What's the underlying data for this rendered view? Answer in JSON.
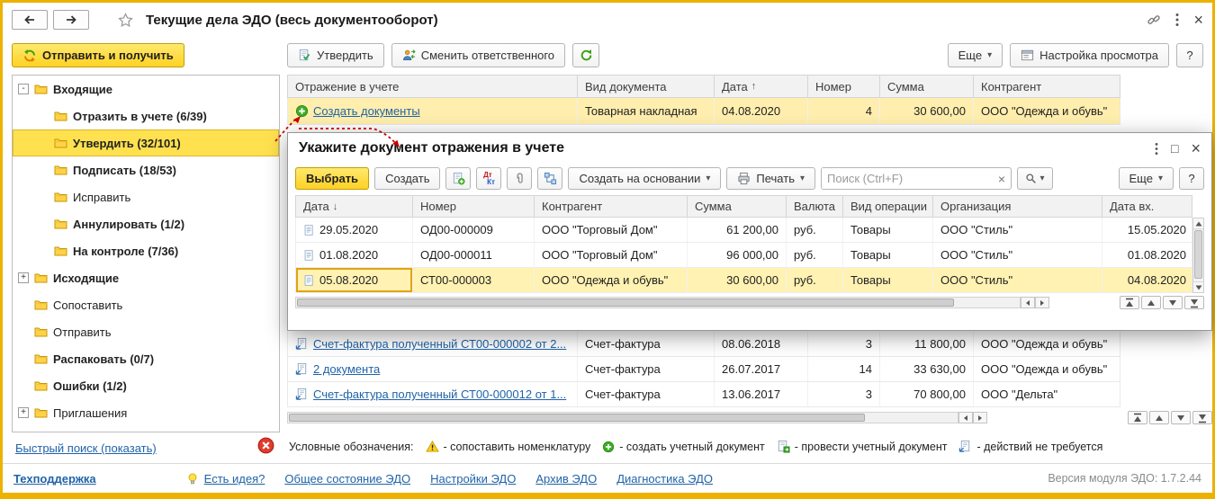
{
  "window": {
    "title": "Текущие дела ЭДО (весь документооборот)",
    "close": "×"
  },
  "toolbar": {
    "send_receive": "Отправить и получить",
    "approve": "Утвердить",
    "change_responsible": "Сменить ответственного",
    "more": "Еще",
    "caret": "▾",
    "view_settings": "Настройка просмотра",
    "help": "?"
  },
  "tree": {
    "items": [
      {
        "label": "Входящие",
        "level": 0,
        "bold": true,
        "expander": "-"
      },
      {
        "label": "Отразить в учете (6/39)",
        "level": 1,
        "bold": true
      },
      {
        "label": "Утвердить (32/101)",
        "level": 1,
        "bold": true,
        "selected": true
      },
      {
        "label": "Подписать (18/53)",
        "level": 1,
        "bold": true
      },
      {
        "label": "Исправить",
        "level": 1,
        "bold": false
      },
      {
        "label": "Аннулировать (1/2)",
        "level": 1,
        "bold": true
      },
      {
        "label": "На контроле (7/36)",
        "level": 1,
        "bold": true
      },
      {
        "label": "Исходящие",
        "level": 0,
        "bold": true,
        "expander": "+"
      },
      {
        "label": "Сопоставить",
        "level": 0,
        "bold": false
      },
      {
        "label": "Отправить",
        "level": 0,
        "bold": false
      },
      {
        "label": "Распаковать (0/7)",
        "level": 0,
        "bold": true
      },
      {
        "label": "Ошибки (1/2)",
        "level": 0,
        "bold": true
      },
      {
        "label": "Приглашения",
        "level": 0,
        "bold": false,
        "expander": "+"
      }
    ],
    "quick_search": "Быстрый поиск (показать)"
  },
  "main_table": {
    "columns": [
      {
        "label": "Отражение в учете"
      },
      {
        "label": "Вид документа"
      },
      {
        "label": "Дата",
        "sort": "↑"
      },
      {
        "label": "Номер"
      },
      {
        "label": "Сумма"
      },
      {
        "label": "Контрагент"
      }
    ],
    "rows": [
      {
        "doc": "Создать документы",
        "type": "Товарная накладная",
        "date": "04.08.2020",
        "number": "4",
        "sum": "30 600,00",
        "contragent": "ООО \"Одежда и обувь\""
      },
      {
        "doc": "Счет-фактура полученный СТ00-000002 от 2...",
        "type": "Счет-фактура",
        "date": "08.06.2018",
        "number": "3",
        "sum": "11 800,00",
        "contragent": "ООО \"Одежда и обувь\""
      },
      {
        "doc": "2 документа",
        "type": "Счет-фактура",
        "date": "26.07.2017",
        "number": "14",
        "sum": "33 630,00",
        "contragent": "ООО \"Одежда и обувь\""
      },
      {
        "doc": "Счет-фактура полученный СТ00-000012 от 1...",
        "type": "Счет-фактура",
        "date": "13.06.2017",
        "number": "3",
        "sum": "70 800,00",
        "contragent": "ООО \"Дельта\""
      }
    ]
  },
  "dialog": {
    "title": "Укажите документ отражения в учете",
    "maximize": "□",
    "close": "×",
    "toolbar": {
      "select": "Выбрать",
      "create": "Создать",
      "create_based": "Создать на основании",
      "print": "Печать",
      "search_placeholder": "Поиск (Ctrl+F)",
      "clear": "×",
      "more": "Еще",
      "help": "?",
      "dt": "Дт",
      "kt": "Кт"
    },
    "table": {
      "columns": [
        {
          "label": "Дата",
          "sort": "↓"
        },
        {
          "label": "Номер"
        },
        {
          "label": "Контрагент"
        },
        {
          "label": "Сумма"
        },
        {
          "label": "Валюта"
        },
        {
          "label": "Вид операции"
        },
        {
          "label": "Организация"
        },
        {
          "label": "Дата вх."
        }
      ],
      "rows": [
        {
          "date": "29.05.2020",
          "number": "ОД00-000009",
          "contragent": "ООО \"Торговый Дом\"",
          "sum": "61 200,00",
          "currency": "руб.",
          "operation": "Товары",
          "org": "ООО \"Стиль\"",
          "date_in": "15.05.2020"
        },
        {
          "date": "01.08.2020",
          "number": "ОД00-000011",
          "contragent": "ООО \"Торговый Дом\"",
          "sum": "96 000,00",
          "currency": "руб.",
          "operation": "Товары",
          "org": "ООО \"Стиль\"",
          "date_in": "01.08.2020"
        },
        {
          "date": "05.08.2020",
          "number": "СТ00-000003",
          "contragent": "ООО \"Одежда и обувь\"",
          "sum": "30 600,00",
          "currency": "руб.",
          "operation": "Товары",
          "org": "ООО \"Стиль\"",
          "date_in": "04.08.2020"
        }
      ]
    }
  },
  "legend": {
    "label": "Условные обозначения:",
    "items": [
      {
        "icon": "warning-triangle",
        "text": "- сопоставить номенклатуру"
      },
      {
        "icon": "green-plus-circle",
        "text": "- создать учетный документ"
      },
      {
        "icon": "post-document",
        "text": "- провести учетный документ"
      },
      {
        "icon": "no-action-document",
        "text": "- действий не требуется"
      }
    ]
  },
  "statusbar": {
    "support": "Техподдержка",
    "idea": "Есть идея?",
    "links": [
      "Общее состояние ЭДО",
      "Настройки ЭДО",
      "Архив ЭДО",
      "Диагностика ЭДО"
    ],
    "version": "Версия модуля ЭДО: 1.7.2.44"
  },
  "icons": {
    "back": "arrow-left",
    "forward": "arrow-right",
    "favorite": "star-outline",
    "get_link": "chain-link",
    "menu": "kebab-dots",
    "close": "×",
    "send_receive": "sync-arrows",
    "approve": "doc-check",
    "change_responsible": "person-swap",
    "refresh": "circular-arrow",
    "view_settings": "list-window",
    "folder": "yellow-folder",
    "create": "green-plus-circle",
    "document": "document-page",
    "warning": "yellow-triangle",
    "paperclip": "paperclip",
    "print": "printer",
    "search": "magnifier",
    "bulb": "lightbulb"
  },
  "colors": {
    "window_border": "#edb200",
    "accent_yellow": "#ffd224",
    "selection": "#ffe14f",
    "row_highlight": "#ffeead",
    "link": "#1f63a8",
    "annotation_arrow": "#c60000"
  }
}
